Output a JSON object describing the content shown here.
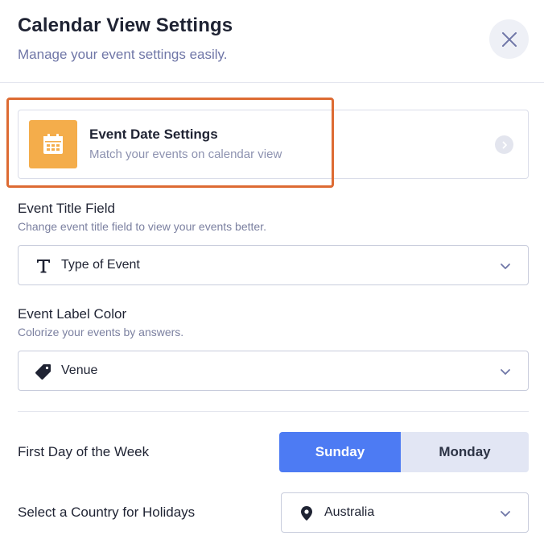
{
  "header": {
    "title": "Calendar View Settings",
    "subtitle": "Manage your event settings easily."
  },
  "date_card": {
    "title": "Event Date Settings",
    "description": "Match your events on calendar view",
    "accent_color": "#f4ad4b",
    "highlight_color": "#dd6b33"
  },
  "title_field": {
    "label": "Event Title Field",
    "help": "Change event title field to view your events better.",
    "value": "Type of Event",
    "icon": "text-type-icon"
  },
  "label_color": {
    "label": "Event Label Color",
    "help": "Colorize your events by answers.",
    "value": "Venue",
    "icon": "tag-icon"
  },
  "first_day": {
    "label": "First Day of the Week",
    "options": [
      "Sunday",
      "Monday"
    ],
    "selected": "Sunday",
    "active_color": "#4d7bf3"
  },
  "holidays": {
    "label": "Select a Country for Holidays",
    "value": "Australia",
    "icon": "location-pin-icon"
  }
}
